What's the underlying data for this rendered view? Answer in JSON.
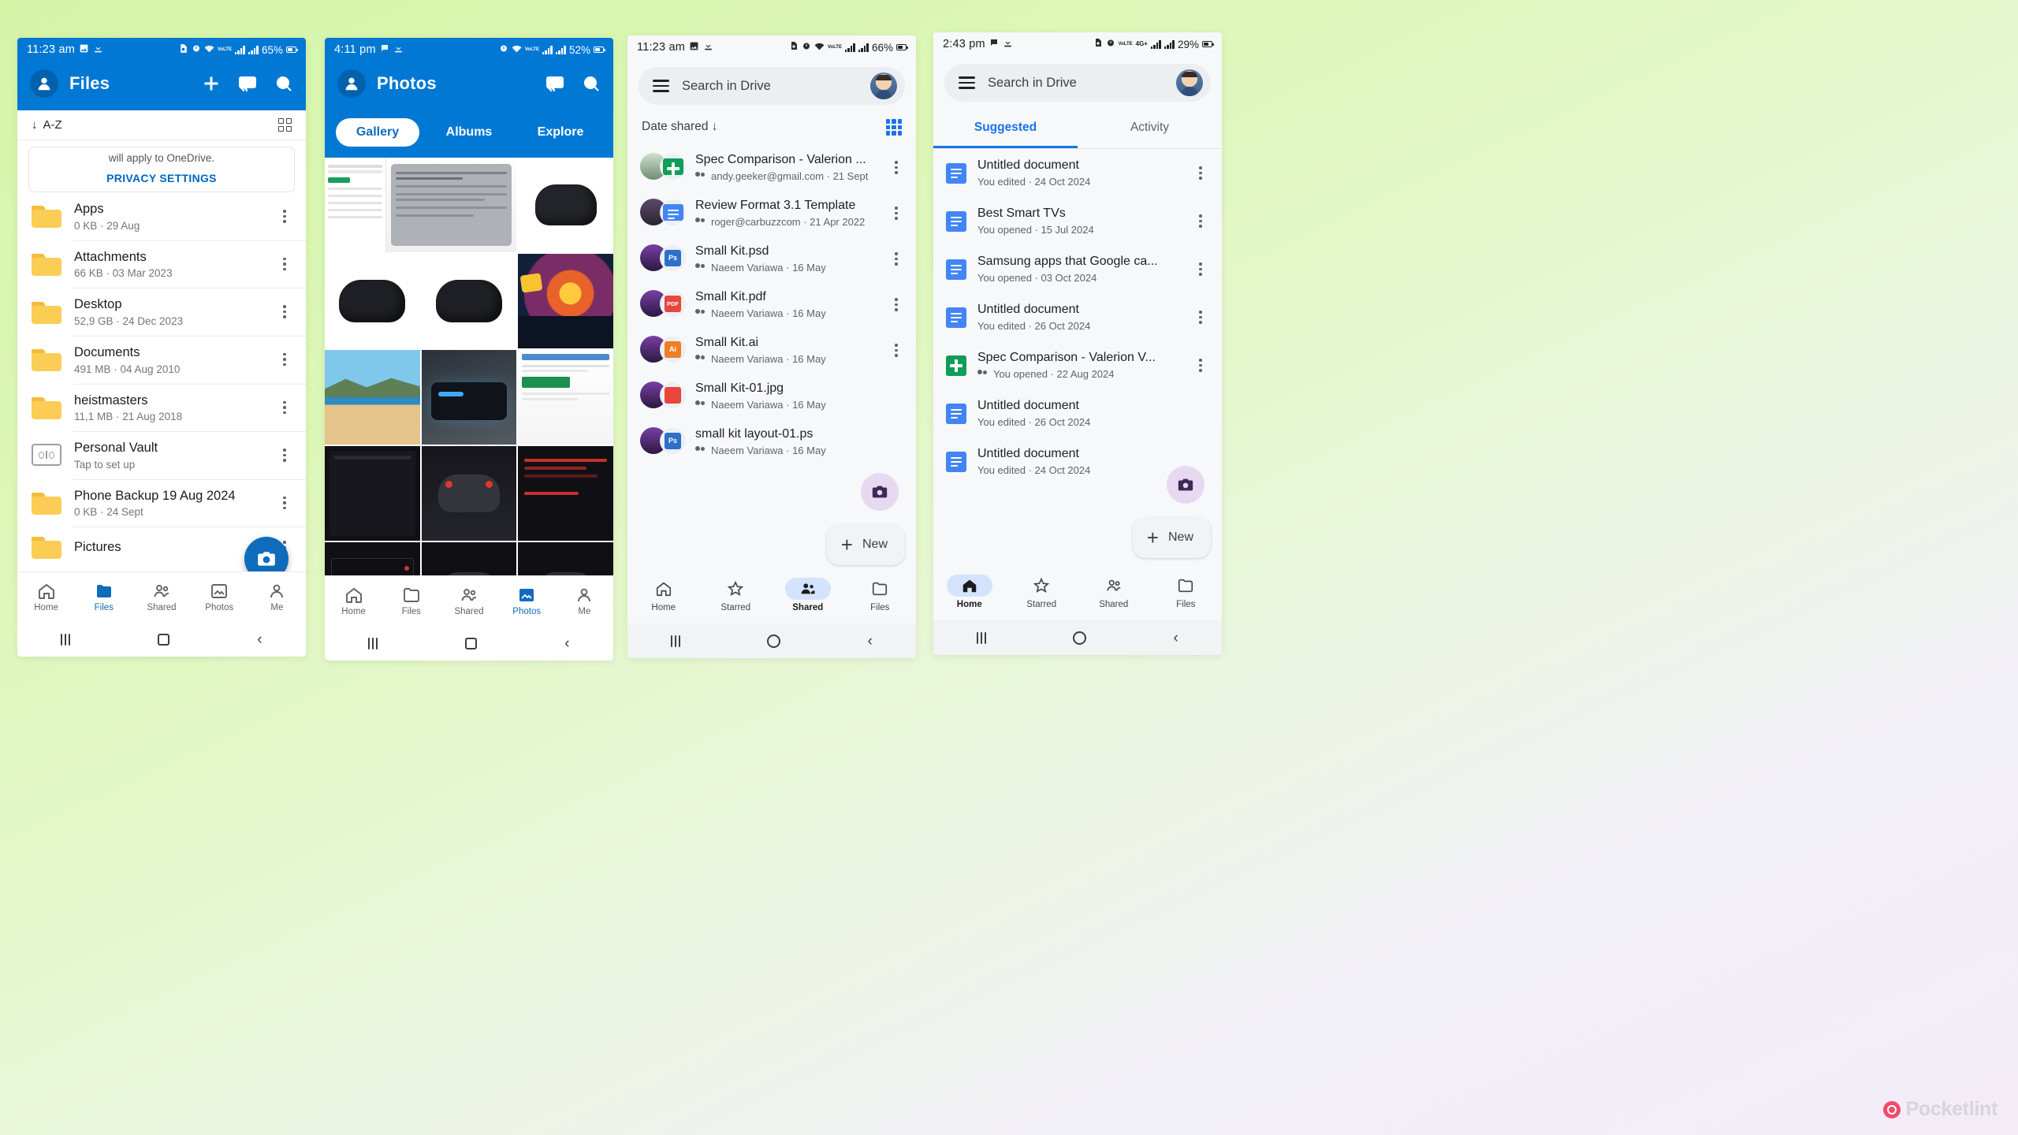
{
  "phones": {
    "p1": {
      "status": {
        "time": "11:23 am",
        "battery": "65%",
        "network": "VoLTE",
        "icons": [
          "image-icon",
          "download-icon",
          "sim-icon",
          "alarm-icon",
          "wifi-icon",
          "signal-icon"
        ]
      },
      "app": "OneDrive",
      "header": {
        "title": "Files",
        "avatar": "account-avatar",
        "actions": [
          "add-icon",
          "cast-icon",
          "search-icon"
        ]
      },
      "sort": {
        "label": "A-Z",
        "direction": "down-arrow-icon"
      },
      "banner": {
        "line1": "will apply to OneDrive.",
        "action": "PRIVACY SETTINGS"
      },
      "files": [
        {
          "name": "Apps",
          "sub": "0 KB · 29 Aug",
          "icon": "folder-icon"
        },
        {
          "name": "Attachments",
          "sub": "66 KB · 03 Mar 2023",
          "icon": "folder-icon"
        },
        {
          "name": "Desktop",
          "sub": "52,9 GB · 24 Dec 2023",
          "icon": "folder-icon"
        },
        {
          "name": "Documents",
          "sub": "491 MB · 04 Aug 2010",
          "icon": "folder-icon"
        },
        {
          "name": "heistmasters",
          "sub": "11,1 MB · 21 Aug 2018",
          "icon": "folder-icon"
        },
        {
          "name": "Personal Vault",
          "sub": "Tap to set up",
          "icon": "vault-icon"
        },
        {
          "name": "Phone Backup 19 Aug 2024",
          "sub": "0 KB · 24 Sept",
          "icon": "folder-icon"
        },
        {
          "name": "Pictures",
          "sub": "",
          "icon": "folder-icon"
        }
      ],
      "fab": "camera-fab",
      "nav": [
        {
          "label": "Home",
          "icon": "home-icon",
          "active": false
        },
        {
          "label": "Files",
          "icon": "files-icon",
          "active": true
        },
        {
          "label": "Shared",
          "icon": "shared-icon",
          "active": false
        },
        {
          "label": "Photos",
          "icon": "photos-icon",
          "active": false
        },
        {
          "label": "Me",
          "icon": "me-icon",
          "active": false
        }
      ]
    },
    "p2": {
      "status": {
        "time": "4:11 pm",
        "battery": "52%",
        "network": "VoLTE"
      },
      "app": "OneDrive Photos",
      "header": {
        "title": "Photos",
        "avatar": "account-avatar",
        "actions": [
          "cast-icon",
          "search-icon"
        ]
      },
      "tabs": [
        {
          "label": "Gallery",
          "active": true
        },
        {
          "label": "Albums",
          "active": false
        },
        {
          "label": "Explore",
          "active": false
        }
      ],
      "grid_note": "photo thumbnails: documents, game controllers, landscape, screenshots",
      "nav": [
        {
          "label": "Home",
          "icon": "home-icon",
          "active": false
        },
        {
          "label": "Files",
          "icon": "files-icon",
          "active": false
        },
        {
          "label": "Shared",
          "icon": "shared-icon",
          "active": false
        },
        {
          "label": "Photos",
          "icon": "photos-icon",
          "active": true
        },
        {
          "label": "Me",
          "icon": "me-icon",
          "active": false
        }
      ]
    },
    "p3": {
      "status": {
        "time": "11:23 am",
        "battery": "66%",
        "network": "VoLTE"
      },
      "app": "Google Drive",
      "search": {
        "placeholder": "Search in Drive",
        "menu": "hamburger-icon",
        "account": "account-avatar"
      },
      "sort": {
        "label": "Date shared",
        "direction": "down-arrow-icon"
      },
      "view_toggle": "grid-view-icon",
      "items": [
        {
          "name": "Spec Comparison - Valerion ...",
          "sub": "andy.geeker@gmail.com · 21 Sept",
          "type": "sheets",
          "color": "#0f9d58"
        },
        {
          "name": "Review Format 3.1 Template",
          "sub": "roger@carbuzzcom · 21 Apr 2022",
          "type": "docs",
          "color": "#4285f4"
        },
        {
          "name": "Small Kit.psd",
          "sub": "Naeem Variawa · 16 May",
          "type": "Ps",
          "color": "#2d6fc9"
        },
        {
          "name": "Small Kit.pdf",
          "sub": "Naeem Variawa · 16 May",
          "type": "PDF",
          "color": "#e8453c"
        },
        {
          "name": "Small Kit.ai",
          "sub": "Naeem Variawa · 16 May",
          "type": "Ai",
          "color": "#f07d27"
        },
        {
          "name": "Small Kit-01.jpg",
          "sub": "Naeem Variawa · 16 May",
          "type": "img",
          "color": "#e8453c"
        },
        {
          "name": "small kit layout-01.ps",
          "sub": "Naeem Variawa · 16 May",
          "type": "Ps",
          "color": "#2d6fc9"
        }
      ],
      "fab_camera": "camera-fab",
      "fab_new": {
        "label": "New",
        "icon": "plus-icon"
      },
      "nav": [
        {
          "label": "Home",
          "icon": "home-icon",
          "active": false
        },
        {
          "label": "Starred",
          "icon": "star-icon",
          "active": false
        },
        {
          "label": "Shared",
          "icon": "shared-icon",
          "active": true
        },
        {
          "label": "Files",
          "icon": "files-icon",
          "active": false
        }
      ]
    },
    "p4": {
      "status": {
        "time": "2:43 pm",
        "battery": "29%",
        "network": "VoLTE",
        "net2": "4G+"
      },
      "app": "Google Drive",
      "search": {
        "placeholder": "Search in Drive",
        "menu": "hamburger-icon",
        "account": "account-avatar"
      },
      "tabs": [
        {
          "label": "Suggested",
          "active": true
        },
        {
          "label": "Activity",
          "active": false
        }
      ],
      "items": [
        {
          "name": "Untitled document",
          "sub": "You edited · 24 Oct 2024",
          "type": "docs"
        },
        {
          "name": "Best Smart TVs",
          "sub": "You opened · 15 Jul 2024",
          "type": "docs"
        },
        {
          "name": "Samsung apps that Google ca...",
          "sub": "You opened · 03 Oct 2024",
          "type": "docs"
        },
        {
          "name": "Untitled document",
          "sub": "You edited · 26 Oct 2024",
          "type": "docs"
        },
        {
          "name": "Spec Comparison - Valerion V...",
          "sub": "You opened · 22 Aug 2024",
          "type": "sheets",
          "shared": true
        },
        {
          "name": "Untitled document",
          "sub": "You edited · 26 Oct 2024",
          "type": "docs"
        },
        {
          "name": "Untitled document",
          "sub": "You edited · 24 Oct 2024",
          "type": "docs"
        }
      ],
      "fab_camera": "camera-fab",
      "fab_new": {
        "label": "New",
        "icon": "plus-icon"
      },
      "nav": [
        {
          "label": "Home",
          "icon": "home-icon",
          "active": true
        },
        {
          "label": "Starred",
          "icon": "star-icon",
          "active": false
        },
        {
          "label": "Shared",
          "icon": "shared-icon",
          "active": false
        },
        {
          "label": "Files",
          "icon": "files-icon",
          "active": false
        }
      ]
    }
  },
  "watermark": {
    "text": "Pocketlint"
  },
  "colors": {
    "onedrive_blue": "#0078d4",
    "drive_blue": "#1a73e8",
    "folder_yellow": "#fbcd55",
    "accent_pill": "#d3e3fd"
  }
}
